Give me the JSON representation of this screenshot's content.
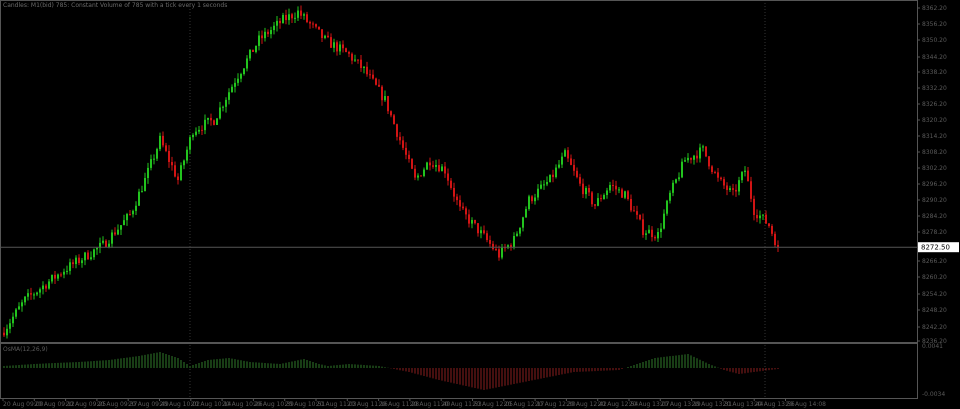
{
  "window": {
    "title": "Candles: M1(bid) 785: Constant Volume of 785 with a tick every 1 seconds",
    "indicator_label": "OsMA(12,26,9)"
  },
  "colors": {
    "background": "#000000",
    "bull": "#22c41e",
    "bear": "#d21414",
    "grid": "#2a2a2a",
    "axis": "#555555",
    "osc_pos": "#2f7a2a",
    "osc_neg": "#8a1e1e",
    "price_line": "#555555"
  },
  "chart_data": {
    "type": "candlestick",
    "title": "Candles: M1(bid) 785",
    "current_price": "8272.50",
    "price_ticks": [
      "8362.20",
      "8356.20",
      "8350.20",
      "8344.20",
      "8338.20",
      "8332.20",
      "8326.20",
      "8320.20",
      "8314.20",
      "8308.20",
      "8302.20",
      "8296.20",
      "8290.20",
      "8284.20",
      "8278.20",
      "8266.20",
      "8260.20",
      "8254.20",
      "8248.20",
      "8242.20",
      "8236.20"
    ],
    "ylim": [
      8230.0,
      8365.2
    ],
    "close_anchors": {
      "bar": [
        0,
        7,
        20,
        33,
        42,
        47,
        52,
        58,
        63,
        70,
        77,
        85,
        93,
        98,
        107,
        115,
        120,
        127,
        132,
        137,
        142,
        147,
        152,
        158,
        165,
        170,
        175,
        182,
        187,
        192,
        197,
        202,
        207,
        213,
        218,
        222,
        227,
        233,
        238,
        243,
        247,
        250,
        255,
        258
      ],
      "price": [
        8241.45,
        8252.7,
        8263.95,
        8273.3,
        8284.6,
        8297.7,
        8312.7,
        8297.7,
        8316.5,
        8320.2,
        8335.2,
        8350.2,
        8357.7,
        8360.7,
        8350.2,
        8344.6,
        8338.95,
        8327.7,
        8312.7,
        8297.7,
        8305.2,
        8301.45,
        8286.45,
        8278.95,
        8269.6,
        8275.2,
        8290.2,
        8297.7,
        8307.1,
        8295.8,
        8288.3,
        8295.8,
        8292.1,
        8278.95,
        8277.1,
        8292.1,
        8305.2,
        8308.95,
        8297.7,
        8292.1,
        8301.45,
        8286.45,
        8280.8,
        8272.5
      ]
    },
    "oscillator": {
      "name": "OsMA(12,26,9)",
      "top_label": "0.0041",
      "bottom_label": "-0.0034",
      "anchors_bar": [
        0,
        10,
        17,
        25,
        35,
        45,
        52,
        58,
        62,
        68,
        75,
        82,
        92,
        100,
        105,
        108,
        115,
        125,
        135,
        145,
        160,
        170,
        180,
        190,
        205,
        217,
        228,
        235,
        240,
        245,
        250,
        258
      ],
      "anchors_value": [
        2,
        4,
        5,
        6,
        8,
        12,
        16,
        10,
        2,
        8,
        10,
        6,
        4,
        9,
        4,
        2,
        4,
        2,
        -4,
        -12,
        -22,
        -16,
        -10,
        -4,
        -2,
        10,
        14,
        4,
        -2,
        -6,
        -4,
        -1
      ]
    },
    "time_labels": [
      "20 Aug 09:00",
      "20 Aug 09:12",
      "20 Aug 09:25",
      "20 Aug 09:37",
      "20 Aug 09:49",
      "20 Aug 10:02",
      "20 Aug 10:14",
      "20 Aug 10:26",
      "20 Aug 10:39",
      "20 Aug 10:51",
      "20 Aug 11:03",
      "20 Aug 11:16",
      "20 Aug 11:28",
      "20 Aug 11:40",
      "20 Aug 11:53",
      "20 Aug 12:05",
      "20 Aug 12:17",
      "20 Aug 12:30",
      "20 Aug 12:42",
      "20 Aug 12:54",
      "20 Aug 13:07",
      "20 Aug 13:19",
      "20 Aug 13:31",
      "20 Aug 13:44",
      "20 Aug 13:56",
      "20 Aug 14:08"
    ]
  }
}
